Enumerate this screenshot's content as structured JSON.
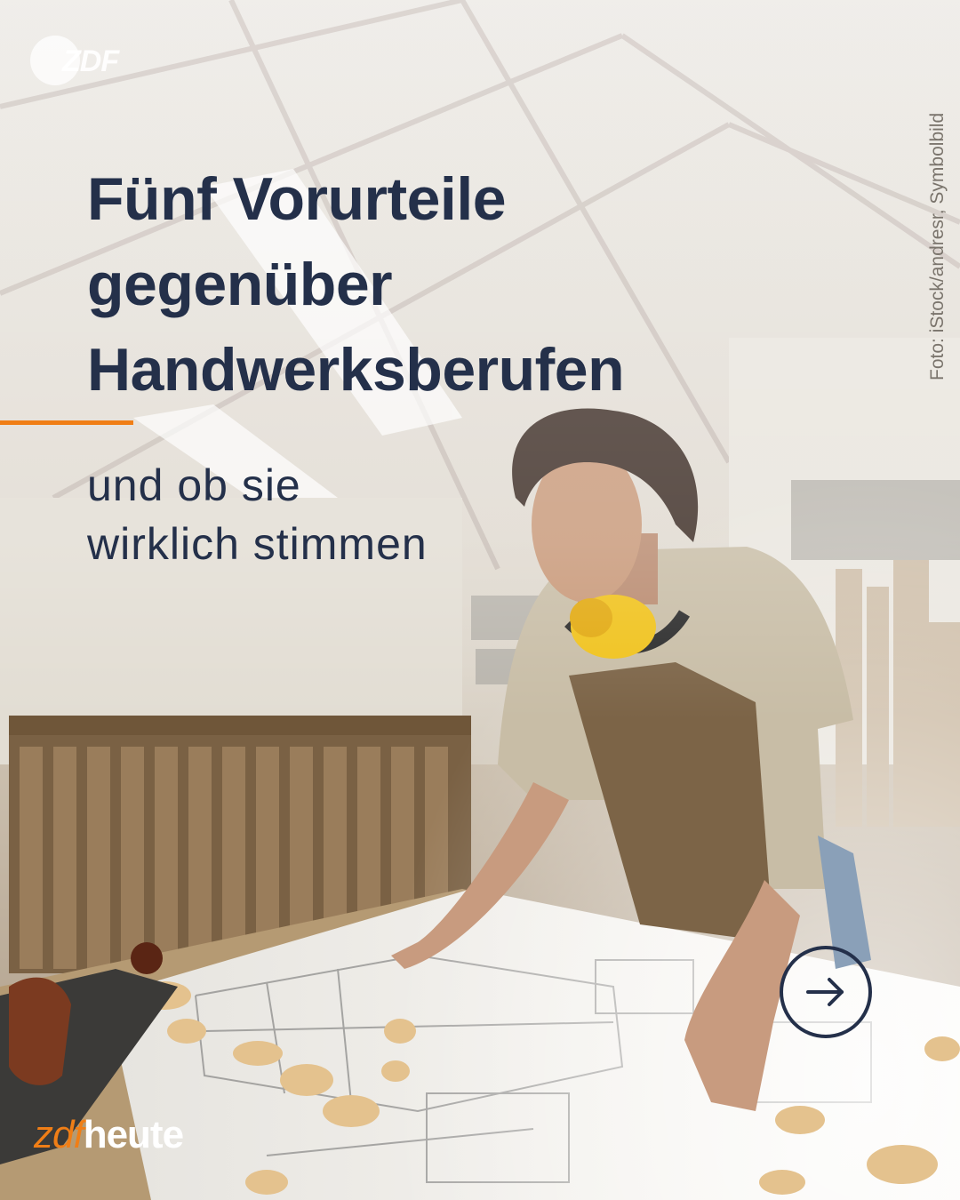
{
  "logo": {
    "text": "ZDF"
  },
  "photo_credit": "Foto: iStock/andresr, Symbolbild",
  "headline": {
    "title_lines": [
      "Fünf Vorurteile",
      "gegenüber",
      "Handwerksberufen"
    ],
    "subtitle_lines": [
      "und ob sie",
      "wirklich stimmen"
    ]
  },
  "brand": {
    "part1": "zdf",
    "part2": "heute"
  },
  "colors": {
    "accent": "#f07e16",
    "text": "#24304a"
  },
  "icons": {
    "next": "arrow-right-circle-icon",
    "logo": "zdf-logo-icon"
  }
}
